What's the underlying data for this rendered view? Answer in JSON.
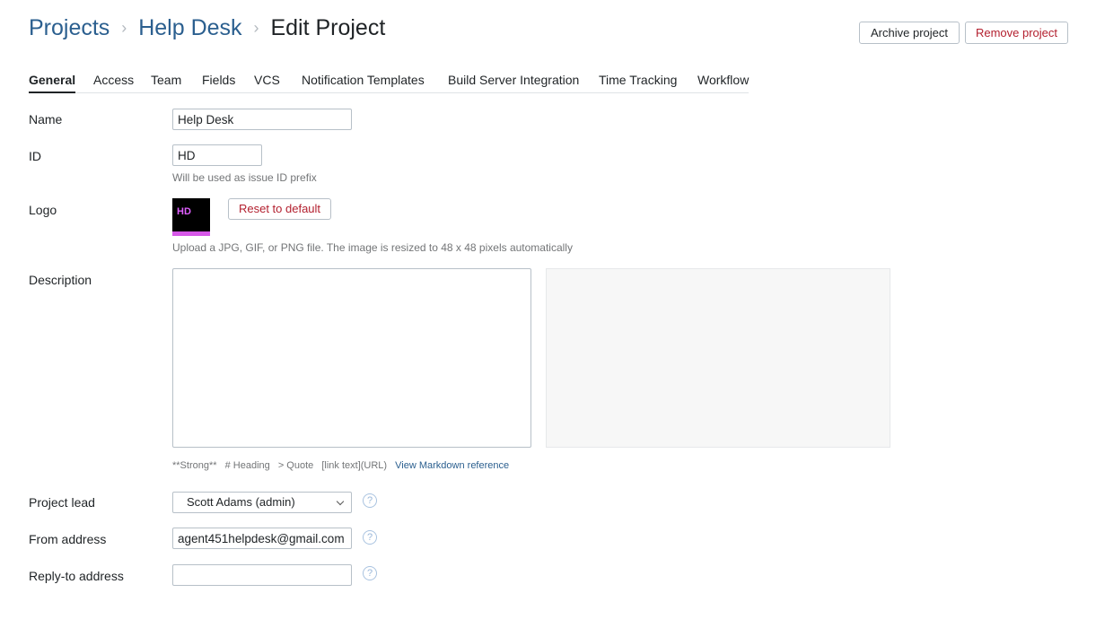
{
  "breadcrumb": {
    "projects": "Projects",
    "project": "Help Desk",
    "separator": "›",
    "current": "Edit Project"
  },
  "actions": {
    "archive": "Archive project",
    "remove": "Remove project"
  },
  "tabs": [
    {
      "label": "General",
      "active": true
    },
    {
      "label": "Access"
    },
    {
      "label": "Team"
    },
    {
      "label": "Fields"
    },
    {
      "label": "VCS"
    },
    {
      "label": "Notification Templates"
    },
    {
      "label": "Build Server Integration"
    },
    {
      "label": "Time Tracking"
    },
    {
      "label": "Workflow"
    }
  ],
  "form": {
    "name": {
      "label": "Name",
      "value": "Help Desk"
    },
    "id": {
      "label": "ID",
      "value": "HD",
      "hint": "Will be used as issue ID prefix"
    },
    "logo": {
      "label": "Logo",
      "logo_text": "HD",
      "reset_label": "Reset to default",
      "hint": "Upload a JPG, GIF, or PNG file. The image is resized to 48 x 48 pixels automatically"
    },
    "description": {
      "label": "Description",
      "value": "",
      "md_hints": [
        "**Strong**",
        "# Heading",
        "> Quote",
        "[link text](URL)"
      ],
      "md_link": "View Markdown reference"
    },
    "project_lead": {
      "label": "Project lead",
      "value": "Scott Adams (admin)"
    },
    "from_address": {
      "label": "From address",
      "value": "agent451helpdesk@gmail.com"
    },
    "reply_to": {
      "label": "Reply-to address",
      "value": ""
    }
  },
  "help_glyph": "?",
  "colors": {
    "link": "#2b5f8f",
    "danger": "#b3202f",
    "logo_accent": "#d658e8"
  }
}
